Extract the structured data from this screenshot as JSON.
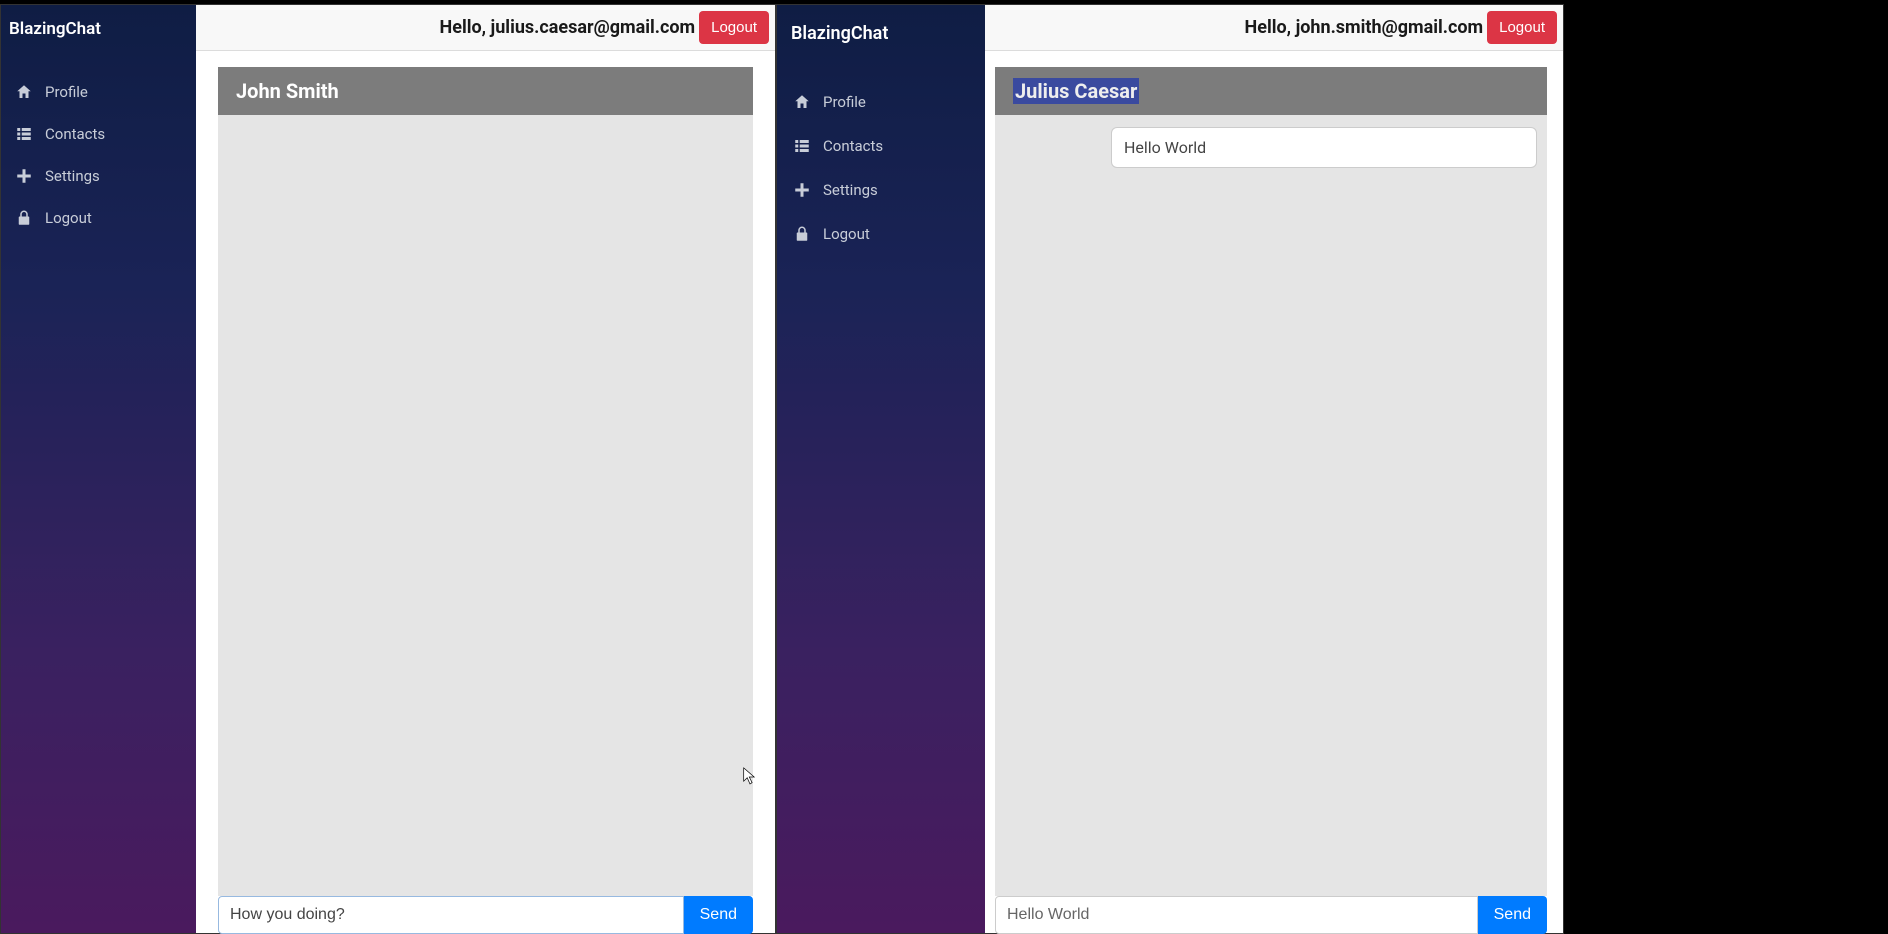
{
  "brand": "BlazingChat",
  "nav": {
    "profile": "Profile",
    "contacts": "Contacts",
    "settings": "Settings",
    "logout": "Logout"
  },
  "logout_btn": "Logout",
  "send_btn": "Send",
  "left": {
    "hello": "Hello, julius.caesar@gmail.com",
    "contact_name": "John Smith",
    "input_value": "How you doing?",
    "messages": []
  },
  "right": {
    "hello": "Hello, john.smith@gmail.com",
    "contact_name": "Julius Caesar",
    "input_value": "Hello World",
    "messages": [
      {
        "text": "Hello World"
      }
    ]
  }
}
